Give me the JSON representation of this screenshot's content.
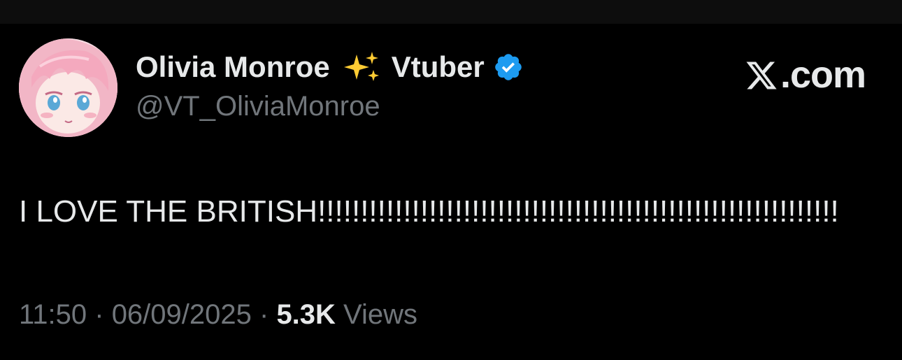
{
  "author": {
    "display_name": "Olivia Monroe",
    "emoji_name": "sparkles-icon",
    "title_suffix": "Vtuber",
    "verified": true,
    "verified_badge_color": "#1d9bf0",
    "handle": "@VT_OliviaMonroe"
  },
  "brand": {
    "logo": "x-logo-icon",
    "label": ".com"
  },
  "tweet": {
    "text": "I LOVE THE BRITISH!!!!!!!!!!!!!!!!!!!!!!!!!!!!!!!!!!!!!!!!!!!!!!!!!!!!!!!!!!!!!"
  },
  "meta": {
    "time": "11:50",
    "separator": " · ",
    "date": "06/09/2025",
    "views_count": "5.3K",
    "views_label": " Views"
  },
  "colors": {
    "background": "#000000",
    "primary_text": "#e7e9ea",
    "secondary_text": "#71767b",
    "verified_blue": "#1d9bf0",
    "sparkle_yellow": "#ffcc33"
  }
}
